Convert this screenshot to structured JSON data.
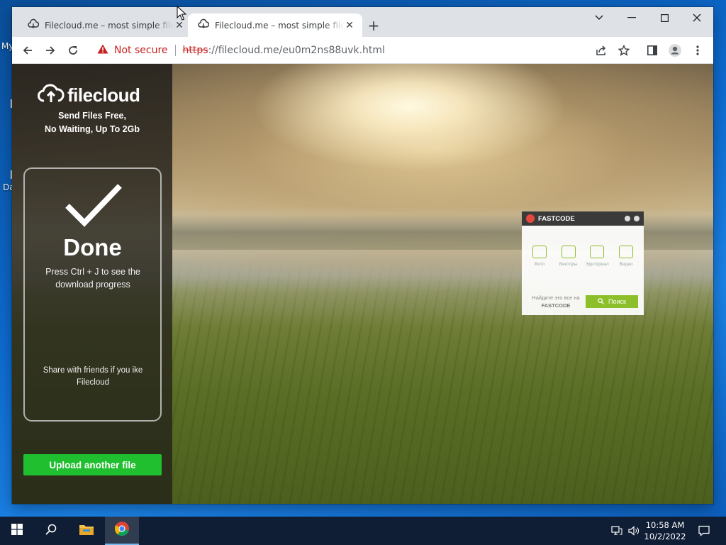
{
  "desktop": {
    "icon_labels": [
      "My",
      "Da"
    ]
  },
  "browser": {
    "tabs": [
      {
        "title": "Filecloud.me – most simple file sharing",
        "close": "✕"
      },
      {
        "title": "Filecloud.me – most simple file sharing",
        "close": "✕"
      }
    ],
    "new_tab": "+",
    "window_controls": {
      "dropdown": "⌄",
      "minimize": "—",
      "maximize": "☐",
      "close": "✕"
    },
    "address": {
      "security_label": "Not secure",
      "url_scheme": "https",
      "url_rest": "://filecloud.me/eu0m2ns88uvk.html"
    }
  },
  "page": {
    "logo_text": "filecloud",
    "tagline_line1": "Send Files Free,",
    "tagline_line2": "No Waiting, Up To 2Gb",
    "done_title": "Done",
    "done_subtitle": "Press Ctrl + J to see the download progress",
    "share_text": "Share with friends if you ike Filecloud",
    "upload_button": "Upload another file"
  },
  "fastcode_widget": {
    "brand": "FASTCODE",
    "items": [
      "Фото",
      "Векторы",
      "Эдиториал",
      "Видео"
    ],
    "find_text": "Найдите это все на",
    "find_brand": "FASTCODE",
    "search_button": "Поиск"
  },
  "taskbar": {
    "time": "10:58 AM",
    "date": "10/2/2022"
  },
  "colors": {
    "accent_green": "#1fbf2f",
    "not_secure_red": "#c5221f",
    "fastcode_green": "#8cbf2a"
  }
}
